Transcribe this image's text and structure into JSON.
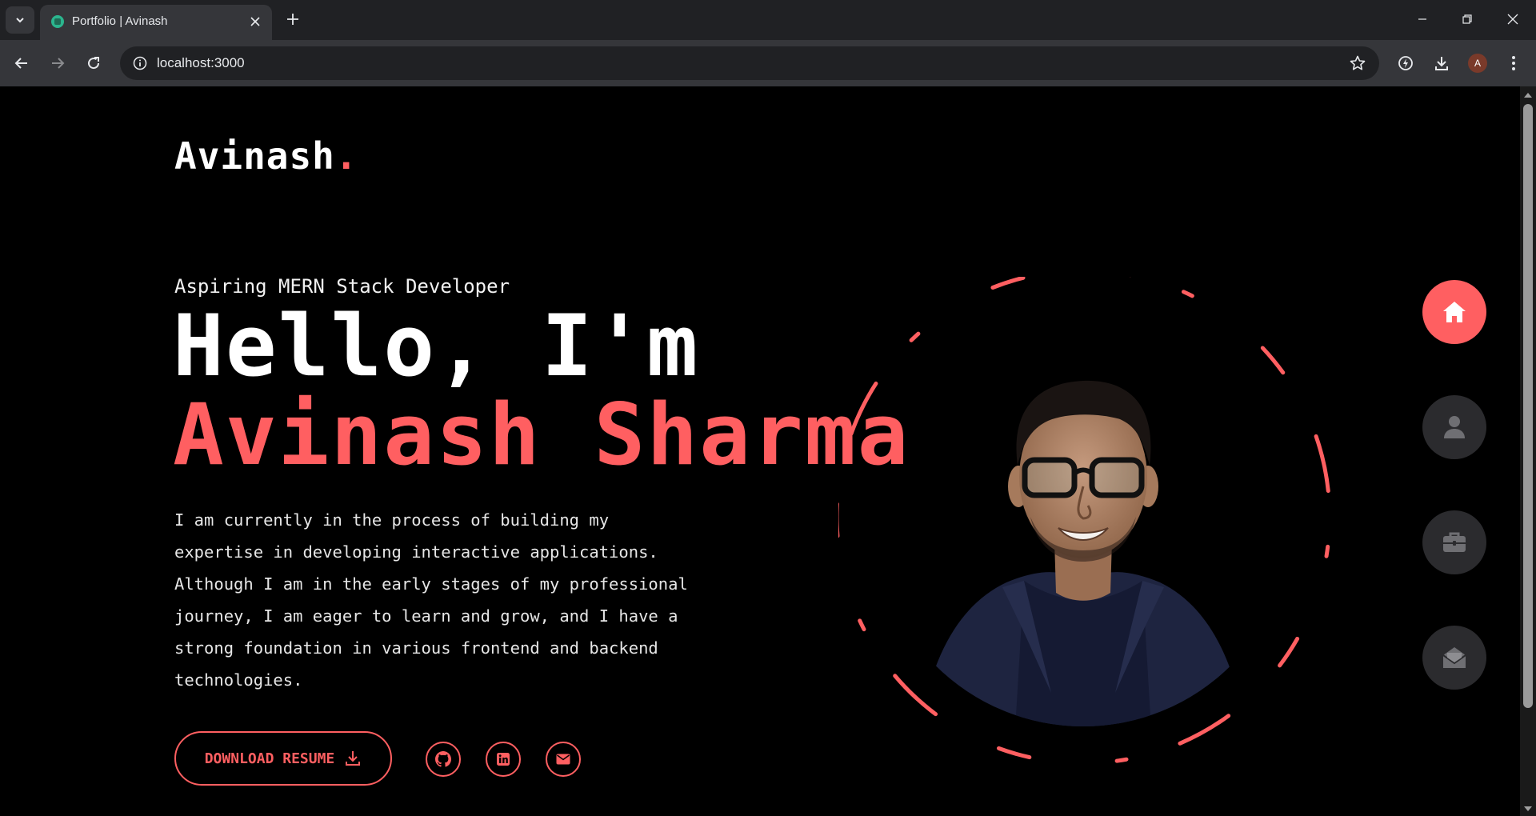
{
  "browser": {
    "tab_title": "Portfolio | Avinash",
    "url": "localhost:3000",
    "profile_initial": "A"
  },
  "page": {
    "logo_text": "Avinash",
    "logo_dot": ".",
    "subtitle": "Aspiring MERN Stack Developer",
    "greeting": "Hello, I'm",
    "name": "Avinash Sharma",
    "bio": "I am currently in the process of building my expertise in developing interactive applications. Although I am in the early stages of my professional journey, I am eager to learn and grow, and I have a strong foundation in various frontend and backend technologies.",
    "resume_button": "DOWNLOAD RESUME",
    "social_icons": [
      "github-icon",
      "linkedin-icon",
      "mail-icon"
    ],
    "side_nav_icons": [
      "home-icon",
      "user-icon",
      "briefcase-icon",
      "envelope-open-icon"
    ],
    "side_nav_active": "home"
  },
  "colors": {
    "accent": "#ff5f61",
    "background": "#000000",
    "nav_inactive": "#2b2b2e",
    "text": "#ffffff"
  }
}
